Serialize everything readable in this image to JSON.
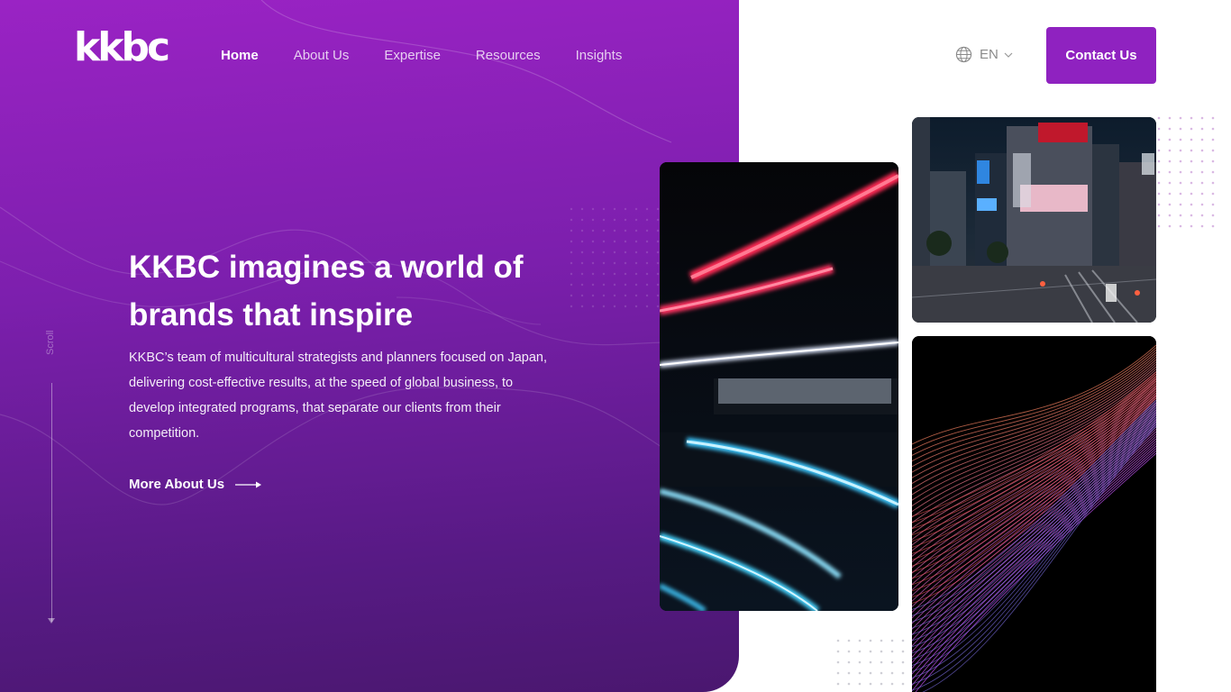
{
  "brand": {
    "logo_text": "kkbc"
  },
  "nav": {
    "items": [
      {
        "label": "Home",
        "active": true
      },
      {
        "label": "About Us",
        "active": false
      },
      {
        "label": "Expertise",
        "active": false
      },
      {
        "label": "Resources",
        "active": false
      },
      {
        "label": "Insights",
        "active": false
      }
    ]
  },
  "language": {
    "code": "EN",
    "icon": "globe-icon"
  },
  "header": {
    "contact_label": "Contact Us"
  },
  "hero": {
    "scroll_label": "Scroll",
    "headline": "KKBC imagines a world of brands that inspire",
    "description": "KKBC’s team of multicultural strategists and planners focused on Japan, delivering cost-effective results, at the speed of global business, to develop integrated programs, that separate our clients from their competition.",
    "cta_label": "More About Us"
  },
  "colors": {
    "accent": "#8f22c0",
    "hero_top": "#9a23c4",
    "hero_bottom": "#4a176f"
  }
}
